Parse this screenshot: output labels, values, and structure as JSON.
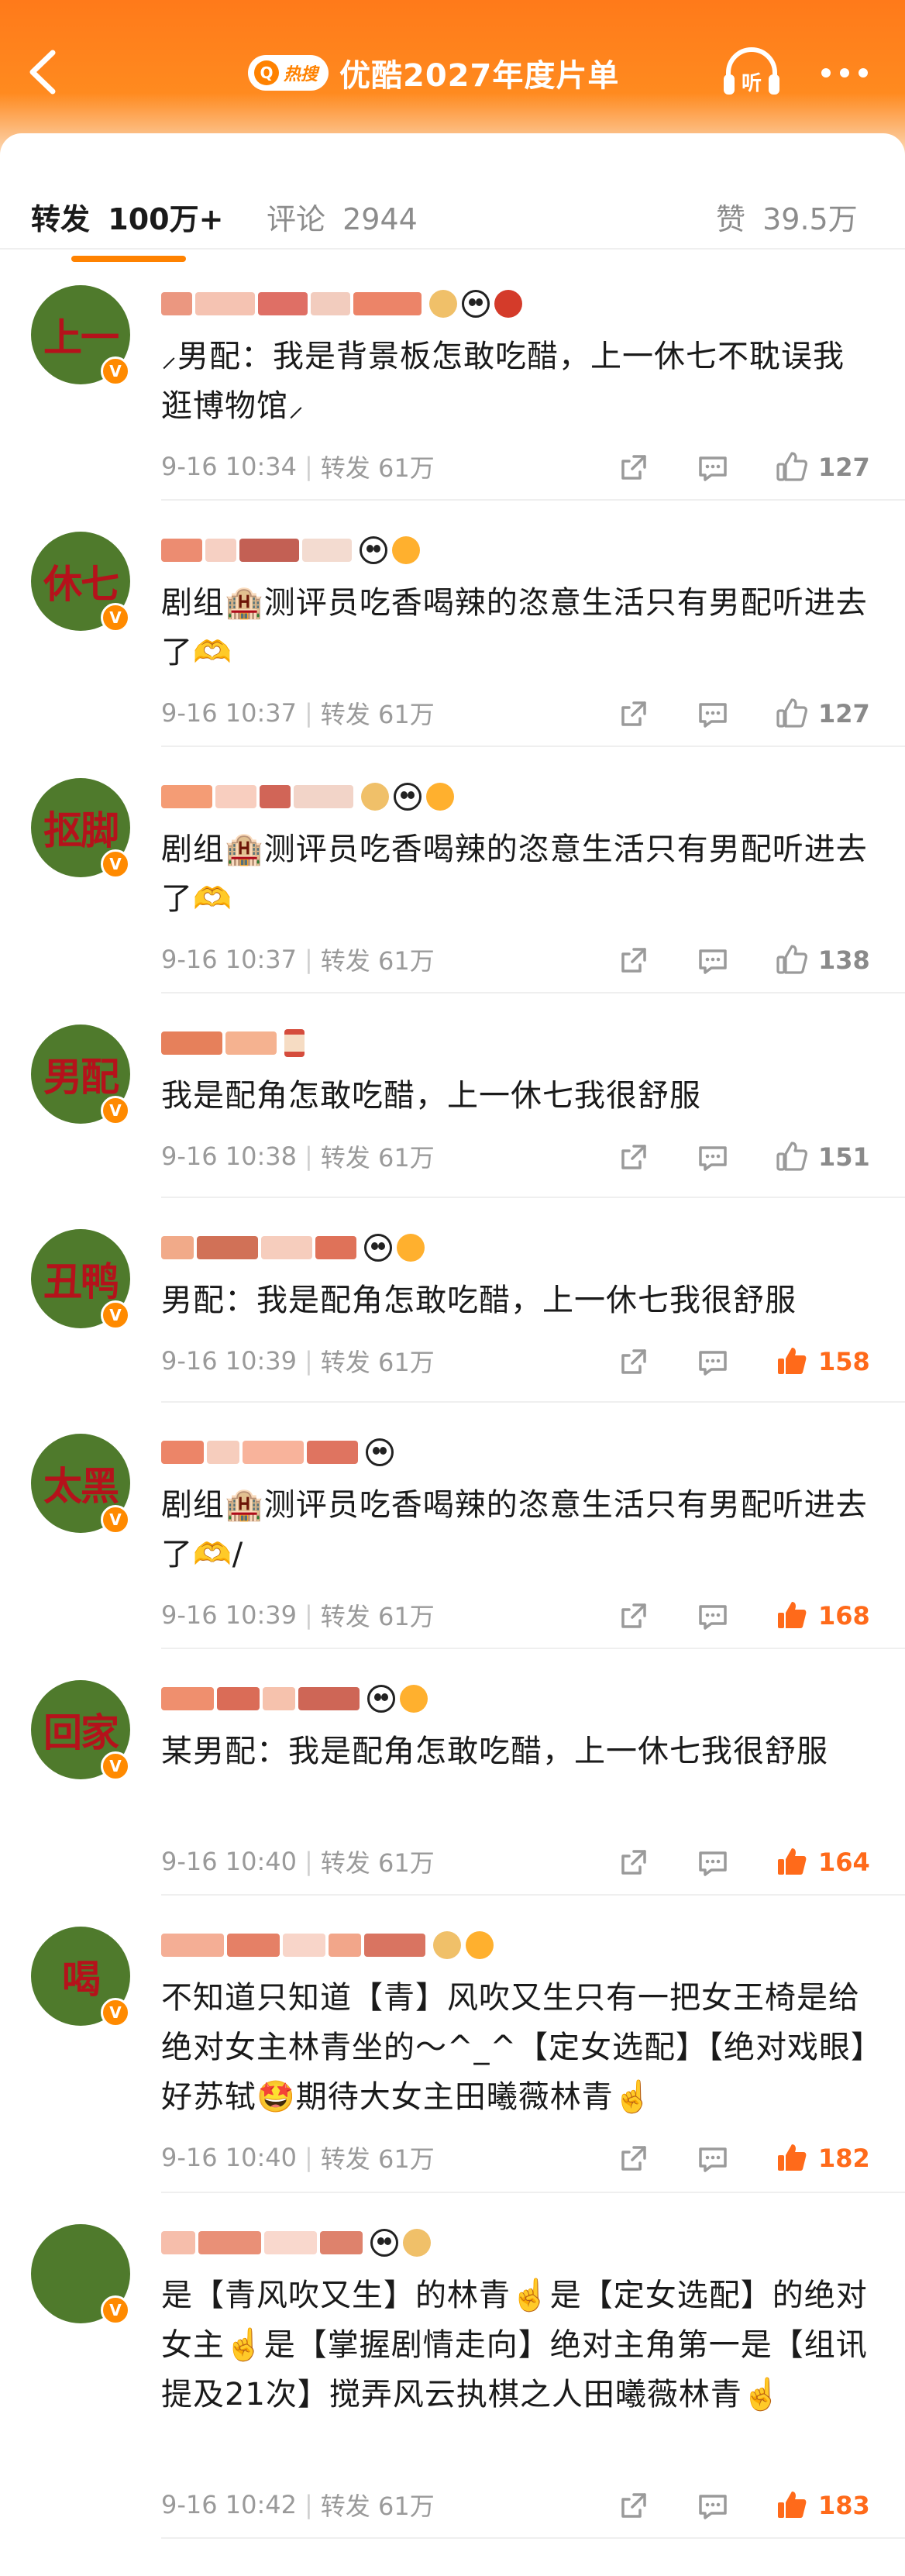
{
  "header": {
    "title": "优酷2027年度片单",
    "hot_badge": "热搜",
    "search_glyph": "Q",
    "back_icon": "chevron-left-icon",
    "listen_label": "听",
    "more_icon": "more-dots-icon",
    "gradient_top": "#ff7a1a"
  },
  "tabs": {
    "repost_label": "转发",
    "repost_count": "100万+",
    "comment_label": "评论",
    "comment_count": "2944",
    "like_label": "赞",
    "like_count": "39.5万"
  },
  "accent_color": "#ff8200",
  "comments": [
    {
      "avatar_text": "上一",
      "text": "⸝男配：我是背景板怎敢吃醋，上一休七不耽误我逛博物馆⸝",
      "time": "9-16 10:34",
      "repost": "转发 61万",
      "likes": "127",
      "liked": false
    },
    {
      "avatar_text": "休七",
      "text": "剧组🏨测评员吃香喝辣的恣意生活只有男配听进去了🫶",
      "time": "9-16 10:37",
      "repost": "转发 61万",
      "likes": "127",
      "liked": false
    },
    {
      "avatar_text": "抠脚",
      "text": "剧组🏨测评员吃香喝辣的恣意生活只有男配听进去了🫶",
      "time": "9-16 10:37",
      "repost": "转发 61万",
      "likes": "138",
      "liked": false
    },
    {
      "avatar_text": "男配",
      "text": "我是配角怎敢吃醋，上一休七我很舒服",
      "time": "9-16 10:38",
      "repost": "转发 61万",
      "likes": "151",
      "liked": false
    },
    {
      "avatar_text": "丑鸭",
      "text": "男配：我是配角怎敢吃醋，上一休七我很舒服",
      "time": "9-16 10:39",
      "repost": "转发 61万",
      "likes": "158",
      "liked": true
    },
    {
      "avatar_text": "太黑",
      "text": "剧组🏨测评员吃香喝辣的恣意生活只有男配听进去了🫶/",
      "time": "9-16 10:39",
      "repost": "转发 61万",
      "likes": "168",
      "liked": true
    },
    {
      "avatar_text": "回家",
      "text": "某男配：我是配角怎敢吃醋，上一休七我很舒服",
      "time": "9-16 10:40",
      "repost": "转发 61万",
      "likes": "164",
      "liked": true
    },
    {
      "avatar_text": "喝",
      "text": "不知道只知道【青】风吹又生只有一把女王椅是给绝对女主林青坐的～^_^【定女选配】【绝对戏眼】好苏轼🤩期待大女主田曦薇林青☝️",
      "time": "9-16 10:40",
      "repost": "转发 61万",
      "likes": "182",
      "liked": true
    },
    {
      "avatar_text": "",
      "text": "是【青风吹又生】的林青☝️是【定女选配】的绝对女主☝️是【掌握剧情走向】绝对主角第一是【组讯提及21次】搅弄风云执棋之人田曦薇林青☝️",
      "time": "9-16 10:42",
      "repost": "转发 61万",
      "likes": "183",
      "liked": true
    }
  ]
}
